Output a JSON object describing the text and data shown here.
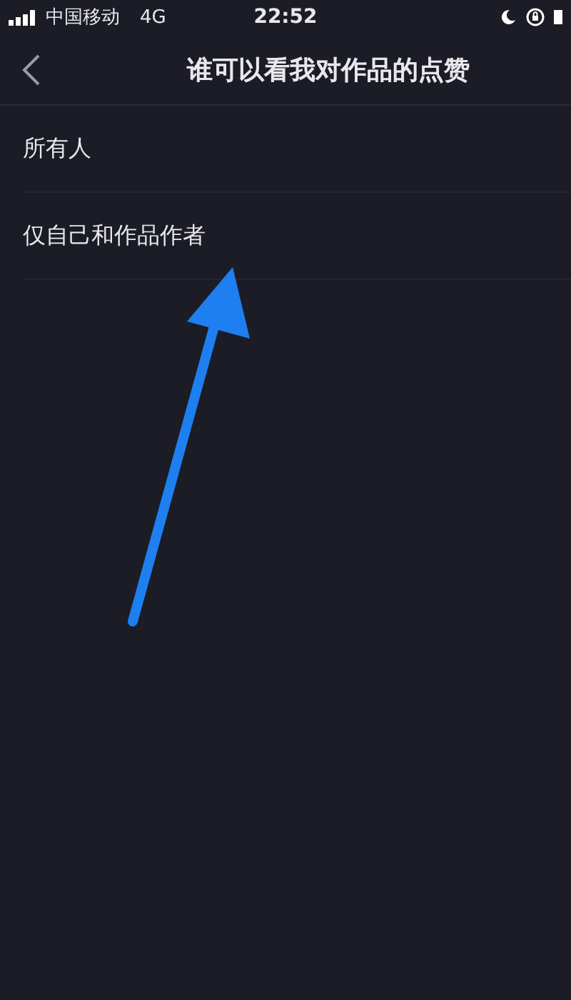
{
  "status_bar": {
    "carrier": "中国移动",
    "network": "4G",
    "time": "22:52"
  },
  "nav": {
    "title": "谁可以看我对作品的点赞"
  },
  "options": [
    {
      "label": "所有人"
    },
    {
      "label": "仅自己和作品作者"
    }
  ]
}
